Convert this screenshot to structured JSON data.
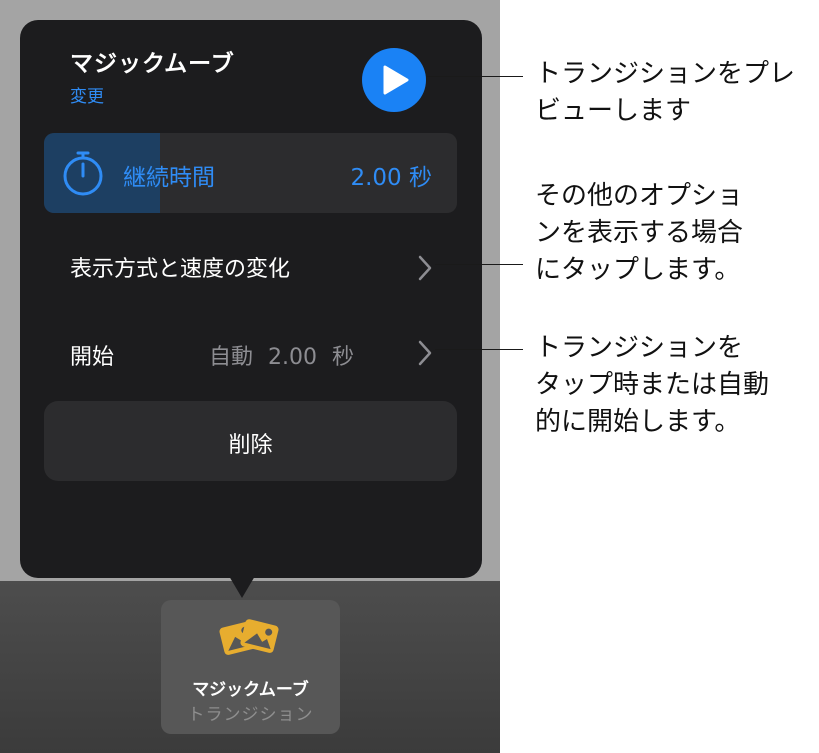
{
  "popover": {
    "title": "マジックムーブ",
    "change_link": "変更",
    "play_icon": "play-icon",
    "duration": {
      "icon": "timer-icon",
      "label": "継続時間",
      "value": "2.00 秒",
      "fill_fraction": 0.28
    },
    "appearance_row": {
      "label": "表示方式と速度の変化",
      "icon": "chevron-right-icon"
    },
    "start_row": {
      "label": "開始",
      "value": "自動  2.00 秒",
      "icon": "chevron-right-icon"
    },
    "delete_label": "削除"
  },
  "transition_tile": {
    "icon": "transition-images-icon",
    "title": "マジックムーブ",
    "subtitle": "トランジション"
  },
  "callouts": {
    "preview": [
      "トランジションをプレ",
      "ビューします"
    ],
    "options": [
      "その他のオプショ",
      "ンを表示する場合",
      "にタップします。"
    ],
    "start": [
      "トランジションを",
      "タップ時または自動",
      "的に開始します。"
    ]
  },
  "colors": {
    "accent": "#2f8cf5",
    "popover_bg": "#1c1c1e",
    "row_bg": "#2c2c2e",
    "duration_fill": "#1d3f62",
    "tile_icon": "#e7ad2f"
  }
}
